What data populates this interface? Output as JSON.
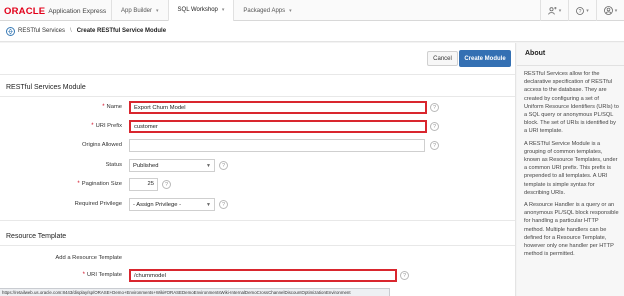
{
  "header": {
    "logo_oracle": "ORACLE",
    "logo_product": "Application Express",
    "tabs": [
      {
        "label": "App Builder"
      },
      {
        "label": "SQL Workshop"
      },
      {
        "label": "Packaged Apps"
      }
    ]
  },
  "breadcrumb": {
    "parent": "RESTful Services",
    "separator": "\\",
    "current": "Create RESTful Service Module"
  },
  "buttons": {
    "cancel": "Cancel",
    "create": "Create Module"
  },
  "module_region": {
    "title": "RESTful Services Module",
    "fields": {
      "name": {
        "label": "Name",
        "value": "Export Churn Model"
      },
      "uri_prefix": {
        "label": "URI Prefix",
        "value": "customer"
      },
      "origins_allowed": {
        "label": "Origins Allowed",
        "value": ""
      },
      "status": {
        "label": "Status",
        "value": "Published"
      },
      "pagination_size": {
        "label": "Pagination Size",
        "value": "25"
      },
      "required_privilege": {
        "label": "Required Privilege",
        "value": "- Assign Privilege -"
      }
    }
  },
  "template_region": {
    "title": "Resource Template",
    "add_label": "Add a Resource Template",
    "uri_template": {
      "label": "URI Template",
      "value": "/churnmodel"
    }
  },
  "about": {
    "title": "About",
    "paragraphs": [
      "RESTful Services allow for the declarative specification of RESTful access to the database. They are created by configuring a set of Uniform Resource Identifiers (URIs) to a SQL query or anonymous PL/SQL block. The set of URIs is identified by a URI template.",
      "A RESTful Service Module is a grouping of common templates, known as Resource Templates, under a common URI prefix. This prefix is prepended to all templates. A URI template is simple syntax for describing URIs.",
      "A Resource Handler is a query or an anonymous PL/SQL block responsible for handling a particular HTTP method. Multiple handlers can be defined for a Resource Template, however only one handler per HTTP method is permitted."
    ]
  },
  "status_url": "https://retailweb.us.oracle.com:8443/display/sp/ORASE+Demo+Environments+Wiki#ORASEDemoEnvironmentsWiki-InternalDemoCrossChannelDiscountOptimizationEnvironment",
  "icons": {
    "help": "?",
    "breadcrumb_icon": "globe-icon"
  }
}
